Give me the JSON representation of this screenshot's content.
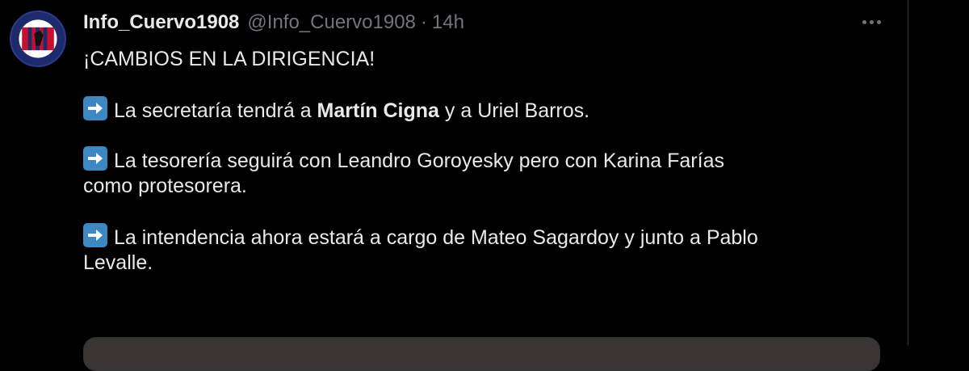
{
  "tweet": {
    "display_name": "Info_Cuervo1908",
    "handle": "@Info_Cuervo1908",
    "separator": "·",
    "time": "14h",
    "headline": "¡CAMBIOS EN LA DIRIGENCIA!",
    "item1": {
      "before": "La secretaría tendrá a ",
      "bold": "Martín Cigna",
      "after": " y a Uriel Barros."
    },
    "item2": {
      "line1": "La tesorería seguirá con Leandro Goroyesky pero con Karina Farías",
      "line2": "como protesorera."
    },
    "item3": {
      "line1": "La intendencia ahora estará a cargo de Mateo Sagardoy y junto a Pablo",
      "line2": "Levalle."
    },
    "emoji": "arrow-right-emoji",
    "more_icon": "more-horizontal-icon",
    "avatar_icon": "club-crest-avatar"
  },
  "colors": {
    "background": "#000000",
    "text_primary": "#e7e9ea",
    "text_secondary": "#71767b",
    "emoji_blue": "#3b88c3",
    "avatar_blue": "#1d2a6b",
    "avatar_red": "#c8102e"
  }
}
